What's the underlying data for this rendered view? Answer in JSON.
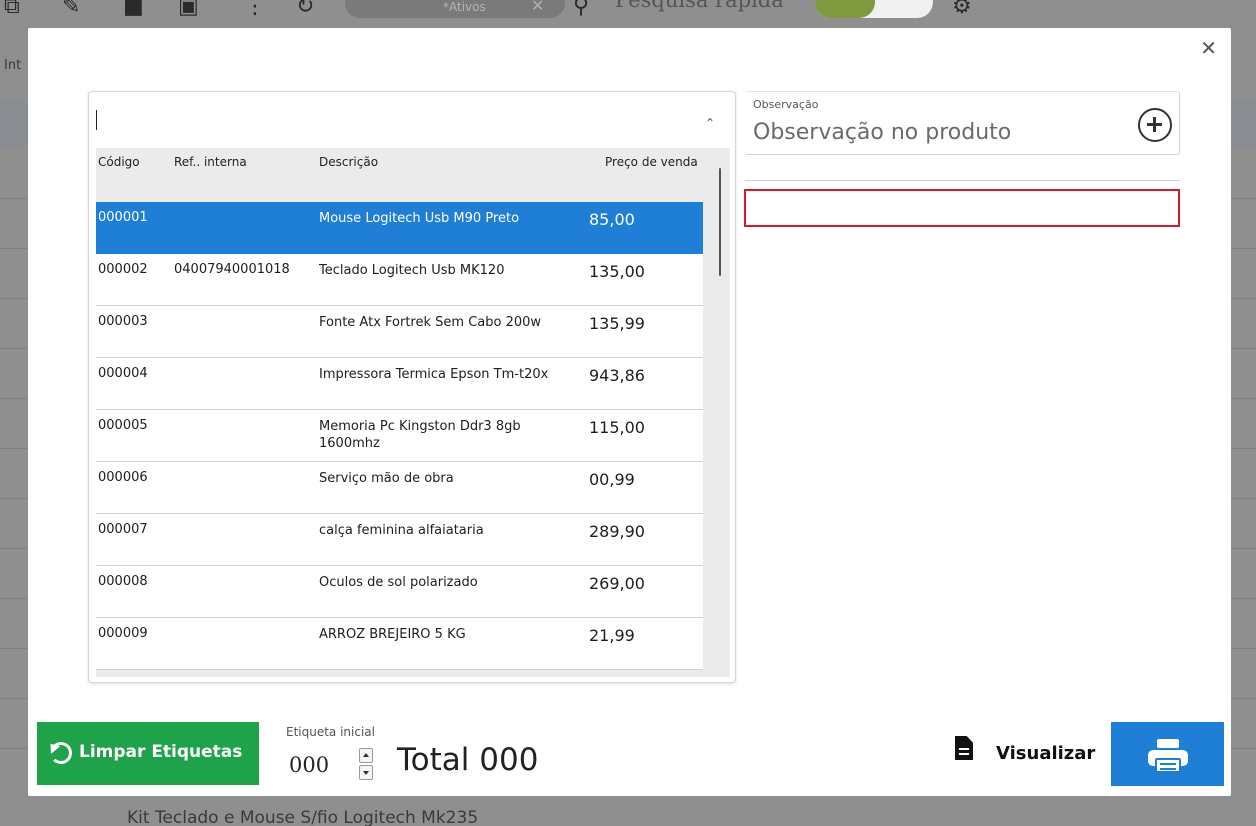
{
  "background": {
    "filter_label": "*Ativos",
    "search_placeholder": "Pesquisa rápida",
    "tab_partial": "Int",
    "bottom_item": "Kit Teclado e Mouse S/fio Logitech Mk235"
  },
  "product_list": {
    "headers": {
      "codigo": "Código",
      "ref": "Ref.. interna",
      "descricao": "Descrição",
      "preco": "Preço de venda"
    },
    "rows": [
      {
        "codigo": "000001",
        "ref": "",
        "descricao": "Mouse Logitech Usb M90 Preto",
        "preco": "85,00",
        "selected": true
      },
      {
        "codigo": "000002",
        "ref": "04007940001018",
        "descricao": "Teclado Logitech Usb MK120",
        "preco": "135,00",
        "selected": false
      },
      {
        "codigo": "000003",
        "ref": "",
        "descricao": "Fonte Atx Fortrek Sem Cabo 200w",
        "preco": "135,99",
        "selected": false
      },
      {
        "codigo": "000004",
        "ref": "",
        "descricao": "Impressora Termica Epson Tm-t20x",
        "preco": "943,86",
        "selected": false
      },
      {
        "codigo": "000005",
        "ref": "",
        "descricao": "Memoria Pc Kingston Ddr3 8gb 1600mhz",
        "preco": "115,00",
        "selected": false
      },
      {
        "codigo": "000006",
        "ref": "",
        "descricao": "Serviço mão de obra",
        "preco": "00,99",
        "selected": false
      },
      {
        "codigo": "000007",
        "ref": "",
        "descricao": "calça feminina alfaiataria",
        "preco": "289,90",
        "selected": false
      },
      {
        "codigo": "000008",
        "ref": "",
        "descricao": "Oculos de sol polarizado",
        "preco": "269,00",
        "selected": false
      },
      {
        "codigo": "000009",
        "ref": "",
        "descricao": "ARROZ BREJEIRO  5 KG",
        "preco": "21,99",
        "selected": false
      }
    ]
  },
  "observation": {
    "label": "Observação",
    "placeholder": "Observação no produto"
  },
  "footer": {
    "clear_label": "Limpar Etiquetas",
    "start_label": "Etiqueta inicial",
    "start_value": "000",
    "total_text": "Total 000",
    "view_label": "Visualizar"
  },
  "colors": {
    "selected_row": "#1f7fd6",
    "clear_button": "#1fa34a",
    "print_button": "#1f7fd6",
    "error_border": "#d81b2c"
  },
  "icons": {
    "close": "close-icon",
    "add": "plus-circle-icon",
    "clear": "refresh-icon",
    "view": "document-icon",
    "print": "printer-icon"
  }
}
